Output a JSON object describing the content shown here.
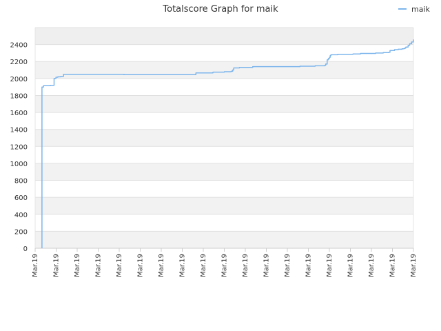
{
  "chart_data": {
    "type": "line",
    "title": "Totalscore Graph for maik",
    "xlabel": "",
    "ylabel": "",
    "ylim": [
      0,
      2600
    ],
    "y_ticks": [
      0,
      200,
      400,
      600,
      800,
      1000,
      1200,
      1400,
      1600,
      1800,
      2000,
      2200,
      2400
    ],
    "x_tick_labels": [
      "Mar.19",
      "Mar.19",
      "Mar.19",
      "Mar.19",
      "Mar.19",
      "Mar.19",
      "Mar.19",
      "Mar.19",
      "Mar.19",
      "Mar.19",
      "Mar.19",
      "Mar.19",
      "Mar.19",
      "Mar.19",
      "Mar.19",
      "Mar.19",
      "Mar.19",
      "Mar.19",
      "Mar.19"
    ],
    "grid": true,
    "legend_position": "top-right",
    "series": [
      {
        "name": "maik",
        "color": "#7cb5ec",
        "x": [
          0.018,
          0.018,
          0.022,
          0.03,
          0.04,
          0.05,
          0.05,
          0.055,
          0.06,
          0.068,
          0.075,
          0.075,
          0.09,
          0.13,
          0.2,
          0.235,
          0.235,
          0.3,
          0.36,
          0.4,
          0.4,
          0.425,
          0.43,
          0.47,
          0.475,
          0.5,
          0.51,
          0.518,
          0.522,
          0.525,
          0.54,
          0.56,
          0.575,
          0.58,
          0.62,
          0.66,
          0.7,
          0.7,
          0.74,
          0.76,
          0.766,
          0.768,
          0.772,
          0.775,
          0.778,
          0.78,
          0.782,
          0.8,
          0.84,
          0.86,
          0.88,
          0.9,
          0.92,
          0.935,
          0.938,
          0.95,
          0.96,
          0.97,
          0.975,
          0.978,
          0.98,
          0.986,
          0.99,
          0.995,
          1.0
        ],
        "values": [
          0,
          1900,
          1915,
          1915,
          1920,
          1925,
          2000,
          2015,
          2020,
          2025,
          2030,
          2050,
          2050,
          2050,
          2050,
          2050,
          2045,
          2045,
          2045,
          2045,
          2045,
          2065,
          2065,
          2075,
          2075,
          2080,
          2080,
          2085,
          2100,
          2125,
          2130,
          2130,
          2140,
          2140,
          2140,
          2140,
          2140,
          2145,
          2150,
          2150,
          2155,
          2170,
          2220,
          2235,
          2250,
          2270,
          2280,
          2285,
          2290,
          2295,
          2295,
          2300,
          2305,
          2310,
          2330,
          2340,
          2345,
          2350,
          2355,
          2360,
          2370,
          2390,
          2410,
          2430,
          2460
        ]
      }
    ]
  }
}
